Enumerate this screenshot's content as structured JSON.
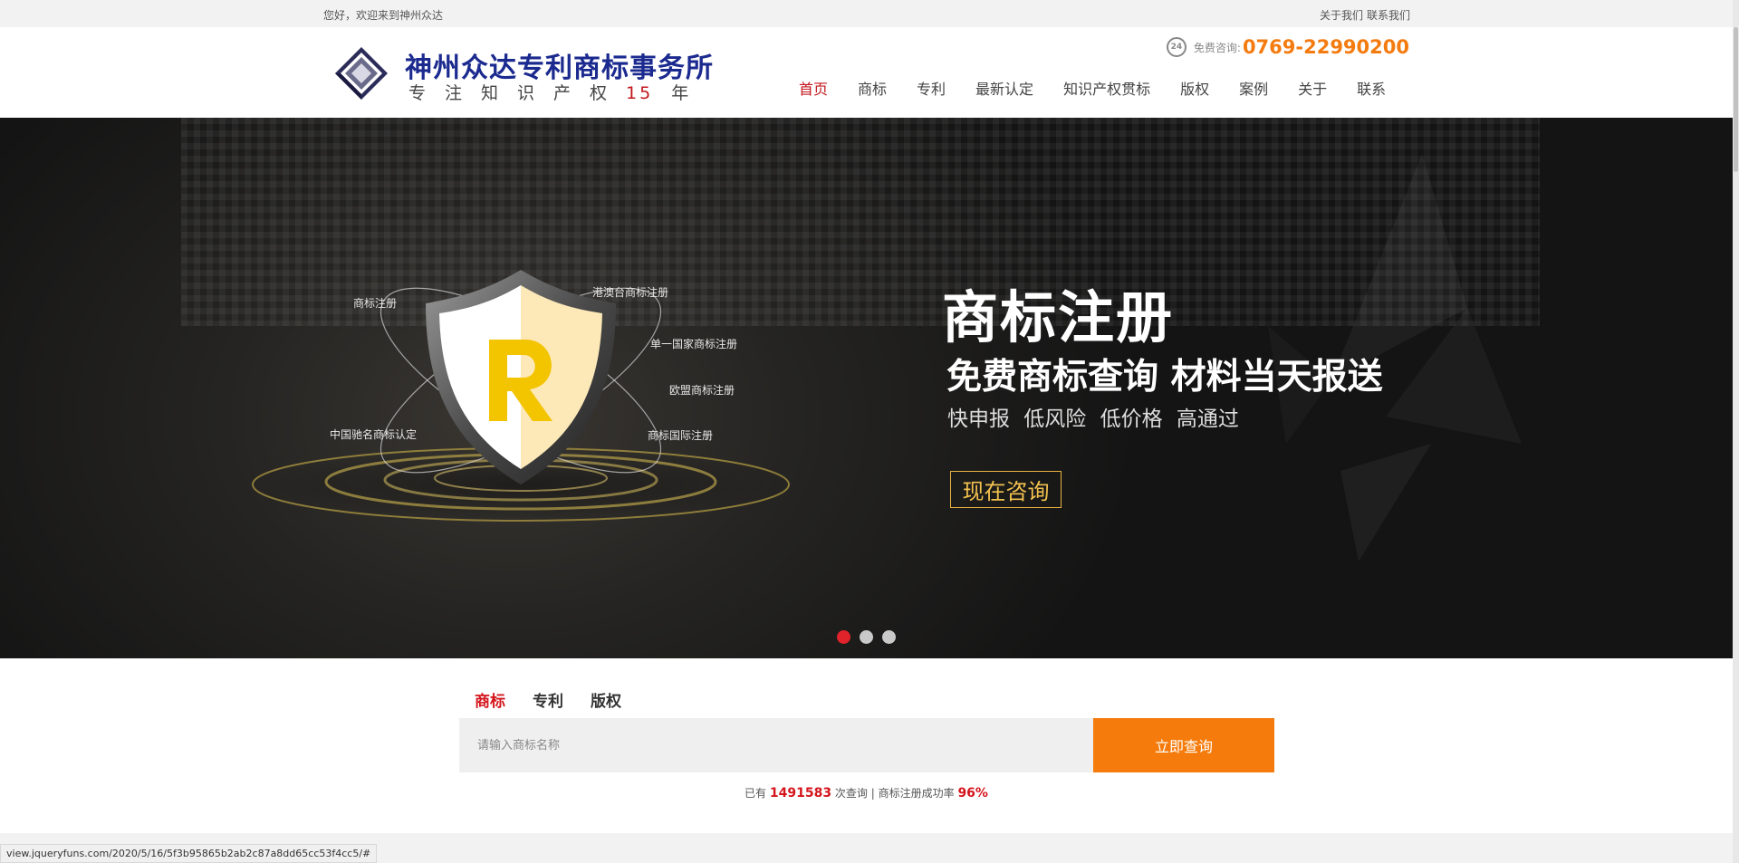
{
  "topbar": {
    "welcome": "您好，欢迎来到神州众达",
    "about_link": "关于我们",
    "contact_link": "联系我们"
  },
  "header": {
    "logo_name": "神州众达专利商标事务所",
    "slogan_prefix": "专注知识产权",
    "slogan_years": "15",
    "slogan_suffix": "年",
    "hotline_label": "免费咨询:",
    "hotline_number": "0769-22990200",
    "hotline_icon_text": "24"
  },
  "nav": {
    "items": [
      {
        "label": "首页",
        "active": true
      },
      {
        "label": "商标"
      },
      {
        "label": "专利"
      },
      {
        "label": "最新认定"
      },
      {
        "label": "知识产权贯标"
      },
      {
        "label": "版权"
      },
      {
        "label": "案例"
      },
      {
        "label": "关于"
      },
      {
        "label": "联系"
      }
    ]
  },
  "banner": {
    "labels": [
      "商标注册",
      "港澳台商标注册",
      "单一国家商标注册",
      "欧盟商标注册",
      "中国驰名商标认定",
      "商标国际注册"
    ],
    "title": "商标注册",
    "subtitle": "免费商标查询 材料当天报送",
    "features": "快申报 低风险 低价格 高通过",
    "cta": "现在咨询",
    "slides": 3,
    "active_slide": 1
  },
  "search": {
    "tabs": [
      "商标",
      "专利",
      "版权"
    ],
    "active_tab": 0,
    "placeholder": "请输入商标名称",
    "button": "立即查询",
    "stats_prefix": "已有",
    "query_count": "1491583",
    "stats_middle": "次查询 | 商标注册成功率",
    "success_rate": "96%"
  },
  "statusbar": {
    "url": "view.jqueryfuns.com/2020/5/16/5f3b95865b2ab2c87a8dd65cc53f4cc5/#"
  },
  "colors": {
    "brand_blue": "#1b2a8f",
    "accent_red": "#c3161c",
    "accent_orange": "#f57c0c",
    "banner_gold": "#f2c14e"
  }
}
